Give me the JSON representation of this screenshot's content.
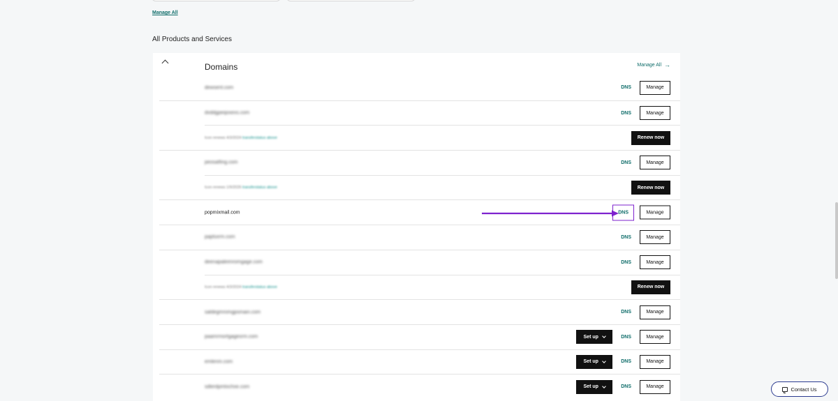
{
  "header": {
    "manage_all_link": "Manage All",
    "section_title": "All Products and Services"
  },
  "panel": {
    "title": "Domains",
    "manage_all": "Manage All",
    "arrow_icon": "→"
  },
  "labels": {
    "dns": "DNS",
    "manage": "Manage",
    "renew": "Renew now",
    "setup": "Set up"
  },
  "rows": [
    {
      "type": "domain",
      "name": "dewsent.com",
      "blurred": true,
      "setup": false
    },
    {
      "type": "domain",
      "name": "dxddgpeqoxexs.com",
      "blurred": true,
      "setup": false
    },
    {
      "type": "renew",
      "text": "Icon renews 4/3/2024",
      "link": "transferstatus above"
    },
    {
      "type": "domain",
      "name": "peosatfing.com",
      "blurred": true,
      "setup": false
    },
    {
      "type": "renew",
      "text": "Icon renews 1/9/2026",
      "link": "transferstatus above"
    },
    {
      "type": "domain",
      "name": "popmixmail.com",
      "blurred": false,
      "setup": false,
      "highlight": true
    },
    {
      "type": "domain",
      "name": "paplsxrm.com",
      "blurred": true,
      "setup": false
    },
    {
      "type": "domain",
      "name": "deenapaleimromgage.com",
      "blurred": true,
      "setup": false
    },
    {
      "type": "renew",
      "text": "Icon renews 4/3/2024",
      "link": "transferstatus above"
    },
    {
      "type": "domain",
      "name": "saldegmromgpsmain.com",
      "blurred": true,
      "setup": false
    },
    {
      "type": "domain",
      "name": "paamrmortgagesrm.com",
      "blurred": true,
      "setup": true
    },
    {
      "type": "domain",
      "name": "emlenm.com",
      "blurred": true,
      "setup": true
    },
    {
      "type": "domain",
      "name": "sdlerdpmtxchxe.com",
      "blurred": true,
      "setup": true
    }
  ],
  "contact": {
    "label": "Contact Us"
  },
  "colors": {
    "accent": "#0f6d6a",
    "highlight": "#7e22ce"
  }
}
